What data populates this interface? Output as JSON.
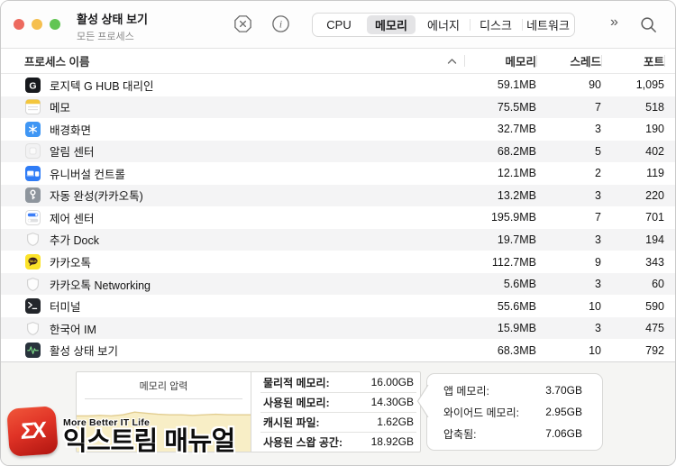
{
  "colors": {
    "accent-red": "#ed6a5f",
    "accent-yellow": "#f5bf4f",
    "accent-green": "#62c554",
    "row-stripe": "#f4f4f5",
    "selected-tab-bg": "#e4e4e6",
    "pressure-fill": "#f8eec6",
    "pressure-line": "#e2cd90",
    "kakao-yellow": "#fce32a",
    "brand-red": "#d92b20"
  },
  "window": {
    "title": "활성 상태 보기",
    "subtitle": "모든 프로세스"
  },
  "toolbar": {
    "overflow": "»",
    "tabs": [
      {
        "label": "CPU"
      },
      {
        "label": "메모리",
        "selected": true
      },
      {
        "label": "에너지"
      },
      {
        "label": "디스크"
      },
      {
        "label": "네트워크"
      }
    ]
  },
  "table": {
    "columns": {
      "name": "프로세스 이름",
      "memory": "메모리",
      "threads": "스레드",
      "ports": "포트"
    },
    "sort": "ascending",
    "rows": [
      {
        "icon": "logitech-g-hub",
        "name": "로지텍 G HUB 대리인",
        "memory": "59.1MB",
        "threads": "90",
        "ports": "1,095"
      },
      {
        "icon": "notes",
        "name": "메모",
        "memory": "75.5MB",
        "threads": "7",
        "ports": "518"
      },
      {
        "icon": "wallpaper",
        "name": "배경화면",
        "memory": "32.7MB",
        "threads": "3",
        "ports": "190"
      },
      {
        "icon": "notification-center",
        "name": "알림 센터",
        "memory": "68.2MB",
        "threads": "5",
        "ports": "402"
      },
      {
        "icon": "universal-control",
        "name": "유니버설 컨트롤",
        "memory": "12.1MB",
        "threads": "2",
        "ports": "119"
      },
      {
        "icon": "autofill-key",
        "name": "자동 완성(카카오톡)",
        "memory": "13.2MB",
        "threads": "3",
        "ports": "220"
      },
      {
        "icon": "control-center",
        "name": "제어 센터",
        "memory": "195.9MB",
        "threads": "7",
        "ports": "701"
      },
      {
        "icon": "shield",
        "name": "추가 Dock",
        "memory": "19.7MB",
        "threads": "3",
        "ports": "194"
      },
      {
        "icon": "kakaotalk",
        "name": "카카오톡",
        "memory": "112.7MB",
        "threads": "9",
        "ports": "343"
      },
      {
        "icon": "shield",
        "name": "카카오톡 Networking",
        "memory": "5.6MB",
        "threads": "3",
        "ports": "60"
      },
      {
        "icon": "terminal",
        "name": "터미널",
        "memory": "55.6MB",
        "threads": "10",
        "ports": "590"
      },
      {
        "icon": "shield",
        "name": "한국어 IM",
        "memory": "15.9MB",
        "threads": "3",
        "ports": "475"
      },
      {
        "icon": "activity-monitor",
        "name": "활성 상태 보기",
        "memory": "68.3MB",
        "threads": "10",
        "ports": "792"
      }
    ]
  },
  "footer": {
    "pressure": {
      "title": "메모리 압력",
      "points": [
        0.66,
        0.66,
        0.67,
        0.66,
        0.68,
        0.73,
        0.71,
        0.69,
        0.68,
        0.68,
        0.67,
        0.68,
        0.69,
        0.68,
        0.68,
        0.68
      ]
    },
    "stats": [
      {
        "label": "물리적 메모리:",
        "value": "16.00GB"
      },
      {
        "label": "사용된 메모리:",
        "value": "14.30GB"
      },
      {
        "label": "캐시된 파일:",
        "value": "1.62GB"
      },
      {
        "label": "사용된 스왑 공간:",
        "value": "18.92GB"
      }
    ],
    "details": [
      {
        "label": "앱 메모리:",
        "value": "3.70GB"
      },
      {
        "label": "와이어드 메모리:",
        "value": "2.95GB"
      },
      {
        "label": "압축됨:",
        "value": "7.06GB"
      }
    ]
  },
  "watermark": {
    "logo_text": "ΣX",
    "tagline": "More Better IT Life",
    "brand": "익스트림 매뉴얼"
  }
}
